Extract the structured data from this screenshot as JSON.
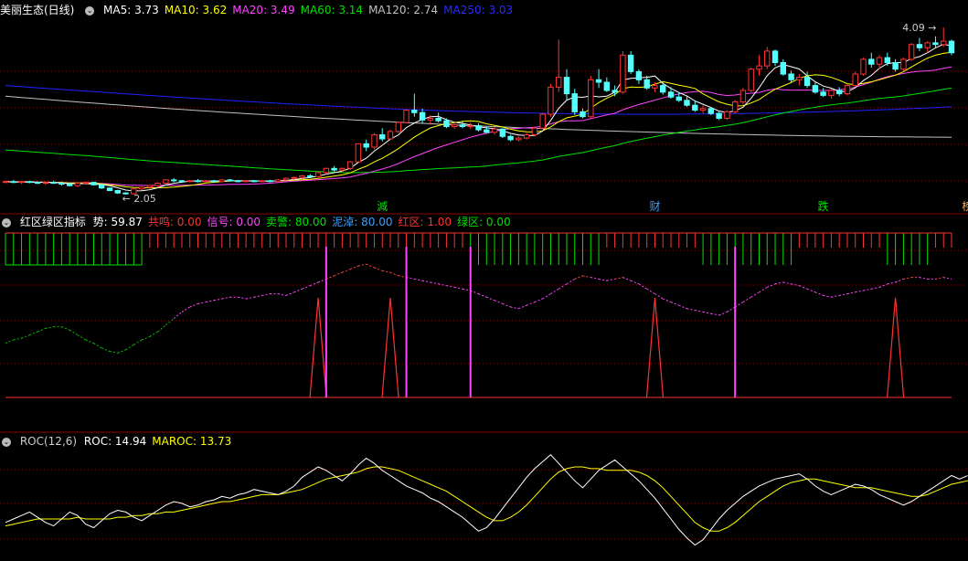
{
  "colors": {
    "up": "#ff3232",
    "down": "#54ffff",
    "ma5": "#ffffff",
    "ma10": "#ffff00",
    "ma20": "#ff44ff",
    "ma60": "#00e000",
    "ma120": "#c0c0c0",
    "ma250": "#2020ff",
    "grid": "#8a0000"
  },
  "header_main": {
    "title": "美丽生态(日线)",
    "items": [
      {
        "label": "MA5: 3.73",
        "color": "#ffffff"
      },
      {
        "label": "MA10: 3.62",
        "color": "#ffff00"
      },
      {
        "label": "MA20: 3.49",
        "color": "#ff44ff"
      },
      {
        "label": "MA60: 3.14",
        "color": "#00e000"
      },
      {
        "label": "MA120: 2.74",
        "color": "#c0c0c0"
      },
      {
        "label": "MA250: 3.03",
        "color": "#2a2aff"
      }
    ]
  },
  "header_ind": {
    "title": "红区绿区指标",
    "items": [
      {
        "label": "势: 59.87",
        "color": "#ffffff"
      },
      {
        "label": "共鸣: 0.00",
        "color": "#ff3232"
      },
      {
        "label": "信号: 0.00",
        "color": "#ff44ff"
      },
      {
        "label": "卖警: 80.00",
        "color": "#00e000"
      },
      {
        "label": "泥淖: 80.00",
        "color": "#3aa0ff"
      },
      {
        "label": "红区: 1.00",
        "color": "#ff3232"
      },
      {
        "label": "绿区: 0.00",
        "color": "#00e000"
      }
    ]
  },
  "header_roc": {
    "title": "ROC(12,6)",
    "items": [
      {
        "label": "ROC: 14.94",
        "color": "#ffffff"
      },
      {
        "label": "MAROC: 13.73",
        "color": "#ffff00"
      }
    ]
  },
  "annotations": {
    "high": "4.09",
    "low": "2.05"
  },
  "markers": [
    {
      "label": "減",
      "color": "#00e000",
      "idx": 47
    },
    {
      "label": "财",
      "color": "#3aa0ff",
      "idx": 81
    },
    {
      "label": "跌",
      "color": "#00e000",
      "idx": 102
    },
    {
      "label": "榜",
      "color": "#ffb060",
      "idx": 120
    }
  ],
  "chart_data": [
    {
      "type": "candlestick",
      "title": "美丽生态(日线)",
      "ylim": [
        1.95,
        4.2
      ],
      "ohlc": [
        [
          2.2,
          2.22,
          2.19,
          2.21
        ],
        [
          2.21,
          2.23,
          2.19,
          2.2
        ],
        [
          2.2,
          2.22,
          2.18,
          2.21
        ],
        [
          2.21,
          2.22,
          2.19,
          2.2
        ],
        [
          2.2,
          2.21,
          2.18,
          2.19
        ],
        [
          2.19,
          2.21,
          2.17,
          2.2
        ],
        [
          2.2,
          2.22,
          2.18,
          2.19
        ],
        [
          2.19,
          2.21,
          2.16,
          2.18
        ],
        [
          2.18,
          2.19,
          2.15,
          2.16
        ],
        [
          2.16,
          2.2,
          2.14,
          2.19
        ],
        [
          2.19,
          2.21,
          2.17,
          2.2
        ],
        [
          2.2,
          2.21,
          2.16,
          2.17
        ],
        [
          2.17,
          2.18,
          2.12,
          2.13
        ],
        [
          2.13,
          2.14,
          2.09,
          2.1
        ],
        [
          2.1,
          2.11,
          2.06,
          2.07
        ],
        [
          2.07,
          2.08,
          2.05,
          2.06
        ],
        [
          2.06,
          2.13,
          2.05,
          2.12
        ],
        [
          2.12,
          2.15,
          2.1,
          2.14
        ],
        [
          2.14,
          2.17,
          2.12,
          2.16
        ],
        [
          2.16,
          2.2,
          2.14,
          2.19
        ],
        [
          2.19,
          2.24,
          2.17,
          2.23
        ],
        [
          2.23,
          2.25,
          2.2,
          2.22
        ],
        [
          2.22,
          2.23,
          2.19,
          2.21
        ],
        [
          2.21,
          2.23,
          2.2,
          2.22
        ],
        [
          2.22,
          2.24,
          2.2,
          2.21
        ],
        [
          2.21,
          2.23,
          2.2,
          2.22
        ],
        [
          2.22,
          2.23,
          2.2,
          2.21
        ],
        [
          2.21,
          2.24,
          2.2,
          2.23
        ],
        [
          2.23,
          2.24,
          2.21,
          2.22
        ],
        [
          2.22,
          2.23,
          2.2,
          2.21
        ],
        [
          2.21,
          2.23,
          2.2,
          2.22
        ],
        [
          2.22,
          2.23,
          2.2,
          2.21
        ],
        [
          2.21,
          2.23,
          2.2,
          2.22
        ],
        [
          2.22,
          2.23,
          2.2,
          2.21
        ],
        [
          2.21,
          2.24,
          2.2,
          2.23
        ],
        [
          2.23,
          2.26,
          2.22,
          2.25
        ],
        [
          2.25,
          2.27,
          2.23,
          2.26
        ],
        [
          2.26,
          2.29,
          2.24,
          2.28
        ],
        [
          2.28,
          2.3,
          2.25,
          2.27
        ],
        [
          2.27,
          2.33,
          2.26,
          2.32
        ],
        [
          2.32,
          2.38,
          2.3,
          2.37
        ],
        [
          2.37,
          2.4,
          2.33,
          2.35
        ],
        [
          2.35,
          2.38,
          2.33,
          2.37
        ],
        [
          2.37,
          2.46,
          2.35,
          2.45
        ],
        [
          2.45,
          2.67,
          2.45,
          2.67
        ],
        [
          2.67,
          2.72,
          2.58,
          2.63
        ],
        [
          2.63,
          2.8,
          2.6,
          2.78
        ],
        [
          2.78,
          2.86,
          2.7,
          2.73
        ],
        [
          2.73,
          2.84,
          2.72,
          2.82
        ],
        [
          2.82,
          2.94,
          2.8,
          2.93
        ],
        [
          2.93,
          3.08,
          2.92,
          3.08
        ],
        [
          3.08,
          3.28,
          3.0,
          3.05
        ],
        [
          3.05,
          3.1,
          2.92,
          2.96
        ],
        [
          2.96,
          3.02,
          2.9,
          2.98
        ],
        [
          2.98,
          3.05,
          2.93,
          2.95
        ],
        [
          2.95,
          2.98,
          2.86,
          2.88
        ],
        [
          2.88,
          2.94,
          2.85,
          2.9
        ],
        [
          2.9,
          2.95,
          2.86,
          2.88
        ],
        [
          2.88,
          2.93,
          2.85,
          2.89
        ],
        [
          2.89,
          2.92,
          2.82,
          2.84
        ],
        [
          2.84,
          2.88,
          2.8,
          2.81
        ],
        [
          2.81,
          2.87,
          2.78,
          2.85
        ],
        [
          2.85,
          2.86,
          2.74,
          2.76
        ],
        [
          2.76,
          2.78,
          2.7,
          2.72
        ],
        [
          2.72,
          2.76,
          2.7,
          2.74
        ],
        [
          2.74,
          2.8,
          2.72,
          2.78
        ],
        [
          2.78,
          2.88,
          2.76,
          2.86
        ],
        [
          2.86,
          3.05,
          2.85,
          3.03
        ],
        [
          3.03,
          3.4,
          3.0,
          3.36
        ],
        [
          3.36,
          3.94,
          3.3,
          3.48
        ],
        [
          3.48,
          3.58,
          3.2,
          3.28
        ],
        [
          3.28,
          3.34,
          3.02,
          3.06
        ],
        [
          3.06,
          3.1,
          2.98,
          3.0
        ],
        [
          3.0,
          3.5,
          2.98,
          3.45
        ],
        [
          3.45,
          3.58,
          3.35,
          3.42
        ],
        [
          3.42,
          3.48,
          3.3,
          3.32
        ],
        [
          3.32,
          3.38,
          3.25,
          3.3
        ],
        [
          3.3,
          3.8,
          3.28,
          3.75
        ],
        [
          3.75,
          3.8,
          3.52,
          3.55
        ],
        [
          3.55,
          3.58,
          3.4,
          3.45
        ],
        [
          3.45,
          3.5,
          3.33,
          3.35
        ],
        [
          3.35,
          3.42,
          3.3,
          3.38
        ],
        [
          3.38,
          3.42,
          3.27,
          3.3
        ],
        [
          3.3,
          3.36,
          3.22,
          3.24
        ],
        [
          3.24,
          3.3,
          3.18,
          3.2
        ],
        [
          3.2,
          3.25,
          3.12,
          3.14
        ],
        [
          3.14,
          3.2,
          3.06,
          3.08
        ],
        [
          3.08,
          3.14,
          3.04,
          3.1
        ],
        [
          3.1,
          3.12,
          3.02,
          3.04
        ],
        [
          3.04,
          3.06,
          2.96,
          2.98
        ],
        [
          2.98,
          3.08,
          2.96,
          3.06
        ],
        [
          3.06,
          3.2,
          3.04,
          3.18
        ],
        [
          3.18,
          3.35,
          3.15,
          3.32
        ],
        [
          3.32,
          3.6,
          3.3,
          3.58
        ],
        [
          3.58,
          3.75,
          3.5,
          3.62
        ],
        [
          3.62,
          3.85,
          3.58,
          3.8
        ],
        [
          3.8,
          3.82,
          3.62,
          3.66
        ],
        [
          3.66,
          3.7,
          3.5,
          3.52
        ],
        [
          3.52,
          3.56,
          3.42,
          3.45
        ],
        [
          3.45,
          3.52,
          3.38,
          3.48
        ],
        [
          3.48,
          3.55,
          3.35,
          3.38
        ],
        [
          3.38,
          3.42,
          3.28,
          3.3
        ],
        [
          3.3,
          3.35,
          3.24,
          3.26
        ],
        [
          3.26,
          3.34,
          3.22,
          3.32
        ],
        [
          3.32,
          3.36,
          3.25,
          3.28
        ],
        [
          3.28,
          3.4,
          3.26,
          3.38
        ],
        [
          3.38,
          3.55,
          3.36,
          3.52
        ],
        [
          3.52,
          3.72,
          3.5,
          3.7
        ],
        [
          3.7,
          3.78,
          3.6,
          3.64
        ],
        [
          3.64,
          3.75,
          3.58,
          3.72
        ],
        [
          3.72,
          3.78,
          3.62,
          3.66
        ],
        [
          3.66,
          3.7,
          3.55,
          3.58
        ],
        [
          3.58,
          3.72,
          3.56,
          3.7
        ],
        [
          3.7,
          3.9,
          3.68,
          3.88
        ],
        [
          3.88,
          3.96,
          3.8,
          3.84
        ],
        [
          3.84,
          3.92,
          3.78,
          3.9
        ],
        [
          3.9,
          3.98,
          3.84,
          3.88
        ],
        [
          3.88,
          4.09,
          3.85,
          3.92
        ],
        [
          3.92,
          3.94,
          3.75,
          3.78
        ]
      ],
      "ma_lines": [
        "MA5",
        "MA10",
        "MA20",
        "MA60",
        "MA120",
        "MA250"
      ],
      "high_label": "4.09",
      "low_label": "2.05"
    },
    {
      "type": "line",
      "title": "红区绿区指标",
      "ylim": [
        0,
        100
      ],
      "series": [
        {
          "name": "势",
          "values": [
            33,
            35,
            36,
            38,
            40,
            42,
            43,
            43,
            41,
            38,
            35,
            33,
            30,
            28,
            27,
            29,
            32,
            35,
            37,
            40,
            44,
            48,
            52,
            55,
            57,
            58,
            59,
            60,
            61,
            61,
            60,
            61,
            62,
            63,
            63,
            62,
            64,
            66,
            68,
            70,
            72,
            74,
            76,
            78,
            80,
            81,
            79,
            77,
            76,
            74,
            73,
            72,
            71,
            70,
            69,
            68,
            67,
            66,
            65,
            63,
            61,
            59,
            57,
            55,
            54,
            56,
            58,
            60,
            63,
            66,
            69,
            72,
            74,
            73,
            72,
            71,
            72,
            73,
            71,
            69,
            66,
            63,
            60,
            58,
            56,
            54,
            53,
            52,
            51,
            50,
            52,
            55,
            58,
            61,
            64,
            67,
            69,
            70,
            69,
            68,
            66,
            64,
            62,
            61,
            62,
            63,
            64,
            65,
            66,
            67,
            69,
            70,
            72,
            73,
            73,
            72,
            72,
            73,
            72,
            70
          ]
        }
      ]
    },
    {
      "type": "line",
      "title": "ROC(12,6)",
      "series": [
        {
          "name": "ROC",
          "values": [
            -12,
            -10,
            -8,
            -6,
            -9,
            -12,
            -14,
            -10,
            -6,
            -8,
            -13,
            -15,
            -11,
            -7,
            -5,
            -6,
            -9,
            -11,
            -8,
            -5,
            -2,
            0,
            -1,
            -3,
            -2,
            0,
            1,
            3,
            2,
            4,
            5,
            7,
            6,
            5,
            4,
            6,
            9,
            14,
            17,
            20,
            18,
            15,
            12,
            16,
            21,
            25,
            22,
            18,
            15,
            12,
            9,
            7,
            5,
            2,
            0,
            -3,
            -6,
            -9,
            -13,
            -17,
            -15,
            -10,
            -4,
            2,
            8,
            14,
            19,
            23,
            27,
            22,
            17,
            12,
            8,
            13,
            18,
            21,
            24,
            20,
            16,
            12,
            7,
            2,
            -4,
            -10,
            -16,
            -21,
            -25,
            -22,
            -16,
            -10,
            -5,
            -1,
            3,
            6,
            9,
            11,
            13,
            14,
            15,
            16,
            13,
            9,
            6,
            4,
            6,
            8,
            10,
            9,
            7,
            4,
            2,
            0,
            -2,
            0,
            3,
            6,
            9,
            12,
            15,
            13,
            14.94
          ]
        },
        {
          "name": "MAROC",
          "values": [
            -14,
            -13,
            -12,
            -11,
            -10,
            -10,
            -10,
            -10,
            -10,
            -9,
            -10,
            -10,
            -10,
            -10,
            -9,
            -9,
            -8,
            -8,
            -7,
            -7,
            -6,
            -6,
            -5,
            -4,
            -3,
            -2,
            -1,
            0,
            0,
            1,
            2,
            3,
            4,
            4,
            4,
            5,
            6,
            7,
            9,
            11,
            13,
            14,
            15,
            16,
            17,
            19,
            20,
            20,
            19,
            18,
            16,
            14,
            12,
            10,
            8,
            6,
            3,
            0,
            -3,
            -6,
            -9,
            -11,
            -11,
            -9,
            -6,
            -2,
            3,
            8,
            13,
            17,
            19,
            20,
            20,
            19,
            19,
            18,
            18,
            18,
            18,
            17,
            15,
            12,
            8,
            3,
            -2,
            -7,
            -12,
            -15,
            -17,
            -17,
            -15,
            -12,
            -8,
            -4,
            0,
            3,
            6,
            9,
            11,
            12,
            13,
            13,
            12,
            11,
            10,
            9,
            8,
            8,
            8,
            7,
            6,
            5,
            4,
            3,
            3,
            4,
            6,
            8,
            10,
            11,
            12,
            13.73
          ]
        }
      ]
    }
  ]
}
